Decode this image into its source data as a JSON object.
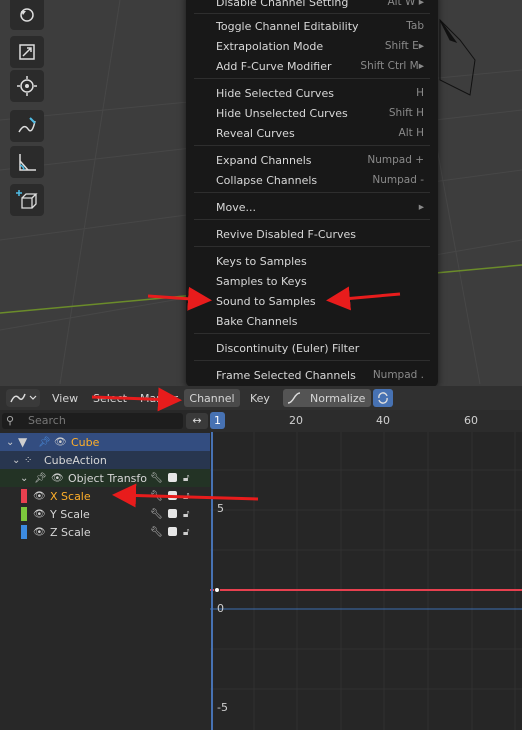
{
  "menu": {
    "items": [
      {
        "label": "Disable Channel Setting",
        "shortcut": "Alt W",
        "has_submenu": true
      },
      {
        "label": "Toggle Channel Editability",
        "shortcut": "Tab"
      },
      {
        "label": "Extrapolation Mode",
        "shortcut": "Shift E",
        "has_submenu": true
      },
      {
        "label": "Add F-Curve Modifier",
        "shortcut": "Shift Ctrl M",
        "has_submenu": true
      },
      {
        "label": "Hide Selected Curves",
        "shortcut": "H"
      },
      {
        "label": "Hide Unselected Curves",
        "shortcut": "Shift H"
      },
      {
        "label": "Reveal Curves",
        "shortcut": "Alt H"
      },
      {
        "label": "Expand Channels",
        "shortcut": "Numpad +"
      },
      {
        "label": "Collapse Channels",
        "shortcut": "Numpad -"
      },
      {
        "label": "Move...",
        "shortcut": "",
        "has_submenu": true
      },
      {
        "label": "Revive Disabled F-Curves",
        "shortcut": ""
      },
      {
        "label": "Keys to Samples",
        "shortcut": ""
      },
      {
        "label": "Samples to Keys",
        "shortcut": ""
      },
      {
        "label": "Sound to Samples",
        "shortcut": ""
      },
      {
        "label": "Bake Channels",
        "shortcut": ""
      },
      {
        "label": "Discontinuity (Euler) Filter",
        "shortcut": ""
      },
      {
        "label": "Frame Selected Channels",
        "shortcut": "Numpad ."
      }
    ]
  },
  "header": {
    "view": "View",
    "select": "Select",
    "marker": "Marker",
    "channel": "Channel",
    "key": "Key",
    "normalize": "Normalize"
  },
  "search": {
    "placeholder": "Search"
  },
  "channels": {
    "object": "Cube",
    "action": "CubeAction",
    "group": "Object Transfo",
    "curves": [
      {
        "name": "X Scale",
        "color": "#e8404f"
      },
      {
        "name": "Y Scale",
        "color": "#7cc83c"
      },
      {
        "name": "Z Scale",
        "color": "#3c8be0"
      }
    ]
  },
  "timeline": {
    "current_frame": "1",
    "frame_labels": [
      "20",
      "40",
      "60"
    ],
    "value_labels": [
      "5",
      "0",
      "-5"
    ]
  },
  "colors": {
    "accent": "#4772b3",
    "selected_text": "#ffaf29",
    "arrow": "#e81c1c"
  }
}
